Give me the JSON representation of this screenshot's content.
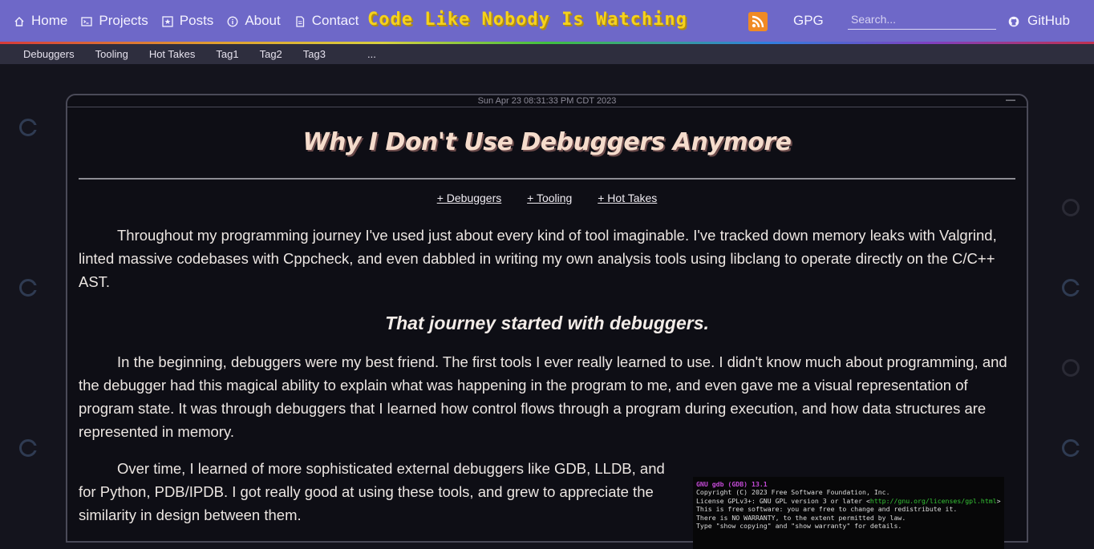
{
  "nav": {
    "items": [
      {
        "label": "Home",
        "icon": "home-icon"
      },
      {
        "label": "Projects",
        "icon": "terminal-icon"
      },
      {
        "label": "Posts",
        "icon": "star-box-icon"
      },
      {
        "label": "About",
        "icon": "info-icon"
      },
      {
        "label": "Contact",
        "icon": "document-icon"
      }
    ],
    "site_title": "Code Like Nobody Is Watching",
    "gpg_label": "GPG",
    "search_placeholder": "Search...",
    "github_label": "GitHub",
    "colors": {
      "nav_bg": "#6e68c8",
      "title": "#f5d21c",
      "rss": "#f08a24"
    }
  },
  "tagbar": {
    "tags": [
      "Debuggers",
      "Tooling",
      "Hot Takes",
      "Tag1",
      "Tag2",
      "Tag3",
      "..."
    ]
  },
  "article": {
    "timestamp": "Sun Apr 23 08:31:33 PM CDT 2023",
    "minimize_label": "—",
    "title": "Why I Don't Use Debuggers Anymore",
    "tag_links": [
      "+ Debuggers",
      "+ Tooling",
      "+ Hot Takes"
    ],
    "paragraph1": "Throughout my programming journey I've used just about every kind of tool imaginable. I've tracked down memory leaks with Valgrind, linted massive codebases with Cppcheck, and even dabbled in writing my own analysis tools using libclang to operate directly on the C/C++ AST.",
    "subheading": "That journey started with debuggers.",
    "paragraph2": "In the beginning, debuggers were my best friend. The first tools I ever really learned to use. I didn't know much about programming, and the debugger had this magical ability to explain what was happening in the program to me, and even gave me a visual representation of program state. It was through debuggers that I learned how control flows through a program during execution, and how data structures are represented in memory.",
    "paragraph3": "Over time, I learned of more sophisticated external debuggers like GDB, LLDB, and for Python, PDB/IPDB. I got really good at using these tools, and grew to appreciate the similarity in design between them."
  },
  "terminal": {
    "line1": "GNU gdb (GDB) 13.1",
    "line2": "Copyright (C) 2023 Free Software Foundation, Inc.",
    "line3_prefix": "License GPLv3+: GNU GPL version 3 or later <",
    "line3_link": "http://gnu.org/licenses/gpl.html",
    "line3_suffix": ">",
    "line4": "This is free software: you are free to change and redistribute it.",
    "line5": "There is NO WARRANTY, to the extent permitted by law.",
    "line6": "Type \"show copying\" and \"show warranty\" for details."
  }
}
